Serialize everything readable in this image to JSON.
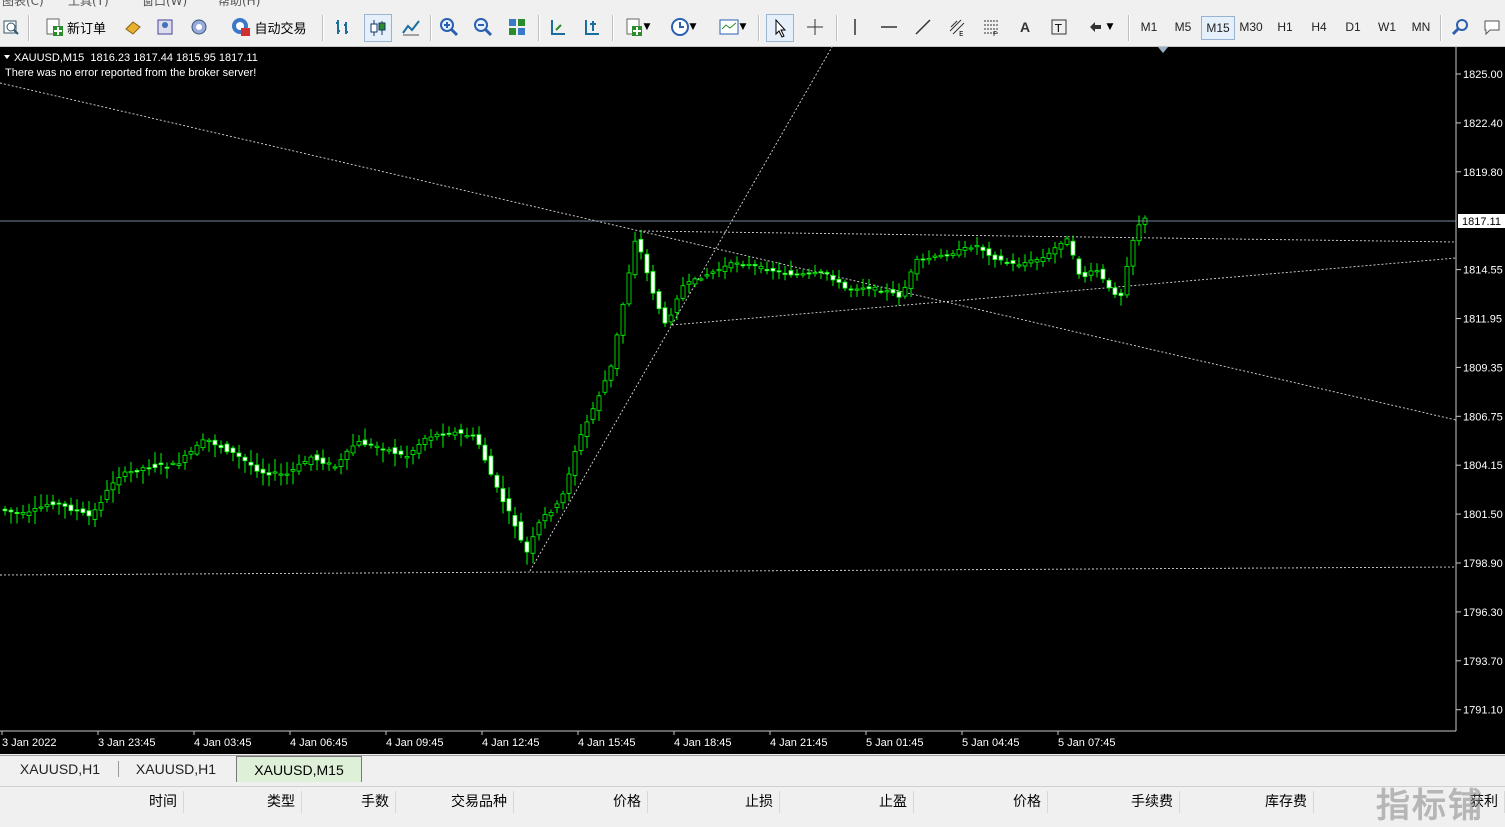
{
  "menu": [
    "图表(C)",
    "工具(T)",
    "窗口(W)",
    "帮助(H)"
  ],
  "toolbar": {
    "new_order_label": "新订单",
    "auto_trade_label": "自动交易",
    "timeframes": [
      "M1",
      "M5",
      "M15",
      "M30",
      "H1",
      "H4",
      "D1",
      "W1",
      "MN"
    ],
    "active_timeframe": "M15"
  },
  "chart": {
    "header_symbol": "XAUUSD,M15  1816.23 1817.44 1815.95 1817.11",
    "header_message": "There was no error reported from the broker server!",
    "current_price_label": "1817.11",
    "price_ticks": [
      "1825.00",
      "1822.40",
      "1819.80",
      "1817.11",
      "1814.55",
      "1811.95",
      "1809.35",
      "1806.75",
      "1804.15",
      "1801.50",
      "1798.90",
      "1796.30",
      "1793.70",
      "1791.10"
    ],
    "time_ticks": [
      "3 Jan 2022",
      "3 Jan 23:45",
      "4 Jan 03:45",
      "4 Jan 06:45",
      "4 Jan 09:45",
      "4 Jan 12:45",
      "4 Jan 15:45",
      "4 Jan 18:45",
      "4 Jan 21:45",
      "5 Jan 01:45",
      "5 Jan 04:45",
      "5 Jan 07:45"
    ],
    "colors": {
      "bull": "#00ff00",
      "bear": "#ffffff",
      "body_bull": "#000000",
      "body_bear": "#ffffff",
      "grid_line": "#9ab0c8"
    }
  },
  "chart_data": {
    "type": "candlestick",
    "symbol": "XAUUSD",
    "timeframe": "M15",
    "ylim": [
      1790.0,
      1826.0
    ],
    "open": 1816.23,
    "high": 1817.44,
    "low": 1815.95,
    "close": 1817.11
  },
  "tabs": [
    "XAUUSD,H1",
    "XAUUSD,H1",
    "XAUUSD,M15"
  ],
  "active_tab": 2,
  "columns": [
    "时间",
    "类型",
    "手数",
    "交易品种",
    "价格",
    "止损",
    "止盈",
    "价格",
    "手续费",
    "库存费",
    "获利"
  ],
  "watermark": "指标铺"
}
